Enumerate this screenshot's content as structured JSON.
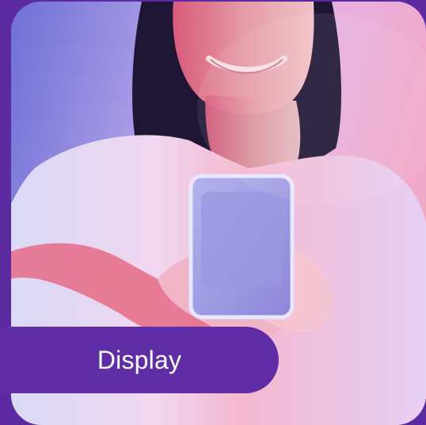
{
  "tile": {
    "label": "Display",
    "image_subject": "woman-holding-smartphone-photo",
    "colors": {
      "frame": "#5b2aa0",
      "label_bg": "#5f2ea6",
      "label_text": "#ffffff"
    }
  }
}
